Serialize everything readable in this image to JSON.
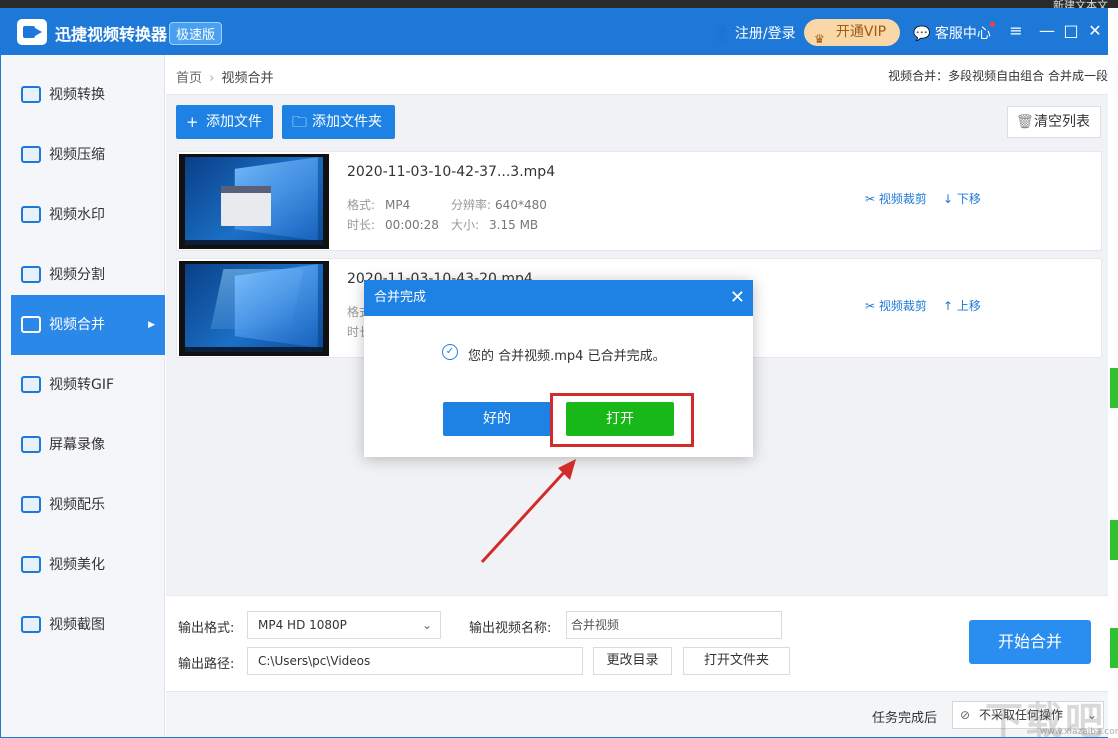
{
  "desktop": {
    "top_right_text": "新建文本文"
  },
  "titlebar": {
    "title": "迅捷视频转换器",
    "edition": "极速版",
    "login": "注册/登录",
    "vip": "开通VIP",
    "service": "客服中心",
    "window_controls": [
      "≡",
      "—",
      "□",
      "✕"
    ]
  },
  "sidebar": {
    "items": [
      {
        "label": "视频转换",
        "icon": "video-convert-icon"
      },
      {
        "label": "视频压缩",
        "icon": "video-compress-icon"
      },
      {
        "label": "视频水印",
        "icon": "video-watermark-icon"
      },
      {
        "label": "视频分割",
        "icon": "video-split-icon"
      },
      {
        "label": "视频合并",
        "icon": "video-merge-icon",
        "active": true
      },
      {
        "label": "视频转GIF",
        "icon": "gif-icon"
      },
      {
        "label": "屏幕录像",
        "icon": "screen-record-icon"
      },
      {
        "label": "视频配乐",
        "icon": "music-icon"
      },
      {
        "label": "视频美化",
        "icon": "beautify-icon"
      },
      {
        "label": "视频截图",
        "icon": "screenshot-icon"
      }
    ]
  },
  "breadcrumb": {
    "home": "首页",
    "sep": "›",
    "current": "视频合并"
  },
  "description": "视频合并：多段视频自由组合 合并成一段",
  "toolbar": {
    "add_file": "添加文件",
    "add_folder": "添加文件夹",
    "clear_list": "清空列表"
  },
  "files": [
    {
      "name": "2020-11-03-10-42-37...3.mp4",
      "format_label": "格式:",
      "format": "MP4",
      "resolution_label": "分辨率:",
      "resolution": "640*480",
      "duration_label": "时长:",
      "duration": "00:00:28",
      "size_label": "大小:",
      "size": "3.15 MB",
      "crop": "视频裁剪",
      "move": "下移",
      "move_arrow": "↓"
    },
    {
      "name": "2020-11-03-10-43-20.mp4",
      "format_label": "格式",
      "duration_label": "时长",
      "crop": "视频裁剪",
      "move": "上移",
      "move_arrow": "↑"
    }
  ],
  "output": {
    "format_label": "输出格式:",
    "format_value": "MP4  HD 1080P",
    "name_label": "输出视频名称:",
    "name_value": "合并视频",
    "path_label": "输出路径:",
    "path_value": "C:\\Users\\pc\\Videos",
    "change_dir": "更改目录",
    "open_folder": "打开文件夹",
    "start": "开始合并"
  },
  "status": {
    "after_label": "任务完成后",
    "after_value": "不采取任何操作"
  },
  "dialog": {
    "title": "合并完成",
    "message": "您的 合并视频.mp4 已合并完成。",
    "ok": "好的",
    "open": "打开"
  },
  "watermark": {
    "main": "下载吧",
    "sub": "www.xiazaiba.com"
  },
  "colors": {
    "brand": "#1e78d8",
    "open_button": "#19b819",
    "highlight": "#d22b2b"
  }
}
